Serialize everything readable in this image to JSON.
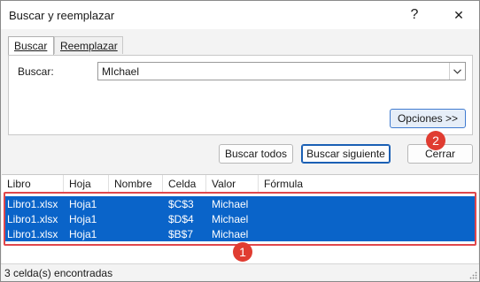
{
  "window": {
    "title": "Buscar y reemplazar",
    "help_symbol": "?",
    "close_symbol": "✕"
  },
  "tabs": [
    {
      "label": "Buscar",
      "active": true
    },
    {
      "label": "Reemplazar",
      "active": false
    }
  ],
  "search": {
    "label": "Buscar:",
    "value": "MIchael"
  },
  "buttons": {
    "options": "Opciones >>",
    "find_all": "Buscar todos",
    "find_next": "Buscar siguiente",
    "close": "Cerrar"
  },
  "results": {
    "columns": [
      "Libro",
      "Hoja",
      "Nombre",
      "Celda",
      "Valor",
      "Fórmula"
    ],
    "rows": [
      {
        "libro": "Libro1.xlsx",
        "hoja": "Hoja1",
        "nombre": "",
        "celda": "$C$3",
        "valor": "Michael",
        "formula": ""
      },
      {
        "libro": "Libro1.xlsx",
        "hoja": "Hoja1",
        "nombre": "",
        "celda": "$D$4",
        "valor": "Michael",
        "formula": ""
      },
      {
        "libro": "Libro1.xlsx",
        "hoja": "Hoja1",
        "nombre": "",
        "celda": "$B$7",
        "valor": "Michael",
        "formula": ""
      }
    ]
  },
  "status": "3 celda(s) encontradas",
  "annotations": {
    "badge_1": "1",
    "badge_2": "2"
  },
  "colors": {
    "selection": "#0a64c9",
    "callout": "#e03c31",
    "accent": "#1a5fb4"
  }
}
